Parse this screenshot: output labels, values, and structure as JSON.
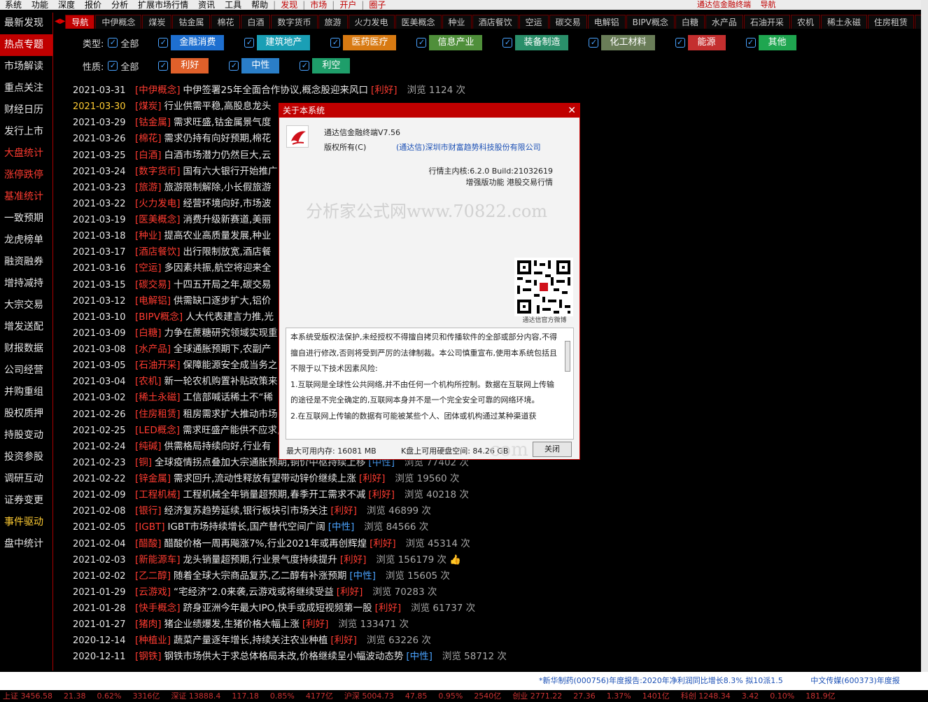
{
  "menu": {
    "items": [
      "系统",
      "功能",
      "深度",
      "报价",
      "分析",
      "扩展市场行情",
      "资讯",
      "工具",
      "帮助"
    ],
    "highlight": [
      "发现",
      "市场",
      "开户",
      "圈子"
    ],
    "brand": "通达信金融终端",
    "nav": "导航"
  },
  "leftnav": {
    "items": [
      {
        "label": "最新发现",
        "style": "normal"
      },
      {
        "label": "热点专题",
        "style": "active"
      },
      {
        "label": "市场解读",
        "style": "normal"
      },
      {
        "label": "重点关注",
        "style": "normal"
      },
      {
        "label": "财经日历",
        "style": "normal"
      },
      {
        "label": "发行上市",
        "style": "normal"
      },
      {
        "label": "大盘统计",
        "style": "red"
      },
      {
        "label": "涨停跌停",
        "style": "red"
      },
      {
        "label": "基准统计",
        "style": "red"
      },
      {
        "label": "一致预期",
        "style": "normal"
      },
      {
        "label": "龙虎榜单",
        "style": "normal"
      },
      {
        "label": "融资融券",
        "style": "normal"
      },
      {
        "label": "增持减持",
        "style": "normal"
      },
      {
        "label": "大宗交易",
        "style": "normal"
      },
      {
        "label": "增发送配",
        "style": "normal"
      },
      {
        "label": "财报数据",
        "style": "normal"
      },
      {
        "label": "公司经营",
        "style": "normal"
      },
      {
        "label": "并购重组",
        "style": "normal"
      },
      {
        "label": "股权质押",
        "style": "normal"
      },
      {
        "label": "持股变动",
        "style": "normal"
      },
      {
        "label": "投资参股",
        "style": "normal"
      },
      {
        "label": "调研互动",
        "style": "normal"
      },
      {
        "label": "证券变更",
        "style": "normal"
      },
      {
        "label": "事件驱动",
        "style": "orange"
      },
      {
        "label": "盘中统计",
        "style": "normal"
      }
    ]
  },
  "tabs": [
    "导航",
    "中伊概念",
    "煤炭",
    "钴金属",
    "棉花",
    "白酒",
    "数字货币",
    "旅游",
    "火力发电",
    "医美概念",
    "种业",
    "酒店餐饮",
    "空运",
    "碳交易",
    "电解铝",
    "BIPV概念",
    "白糖",
    "水产品",
    "石油开采",
    "农机",
    "稀土永磁",
    "住房租赁",
    "MI"
  ],
  "filters": {
    "type_label": "类型:",
    "all_label": "全部",
    "types": [
      {
        "label": "金融消费",
        "color": "#1e6fd0"
      },
      {
        "label": "建筑地产",
        "color": "#1a9fb5"
      },
      {
        "label": "医药医疗",
        "color": "#d87a12"
      },
      {
        "label": "信息产业",
        "color": "#4f8f3a"
      },
      {
        "label": "装备制造",
        "color": "#2a8f6a"
      },
      {
        "label": "化工材料",
        "color": "#6a7d58"
      },
      {
        "label": "能源",
        "color": "#c42f2f"
      },
      {
        "label": "其他",
        "color": "#1fa650"
      }
    ],
    "nature_label": "性质:",
    "natures": [
      {
        "label": "利好",
        "color": "#e0602a"
      },
      {
        "label": "中性",
        "color": "#2a7ec8"
      },
      {
        "label": "利空",
        "color": "#1e9e6a"
      }
    ]
  },
  "news": [
    {
      "date": "2021-03-31",
      "cat": "[中伊概念]",
      "title": "中伊签署25年全面合作协议,概念股迎来风口",
      "tag": "[利好]",
      "tagtype": "good",
      "views": "浏览 1124 次"
    },
    {
      "date": "2021-03-30",
      "cat": "[煤炭]",
      "title": "行业供需平稳,高股息龙头",
      "tag": "",
      "tagtype": "",
      "views": ""
    },
    {
      "date": "2021-03-29",
      "cat": "[钴金属]",
      "title": "需求旺盛,钴金属景气度",
      "tag": "",
      "tagtype": "",
      "views": ""
    },
    {
      "date": "2021-03-26",
      "cat": "[棉花]",
      "title": "需求仍持有向好预期,棉花",
      "tag": "",
      "tagtype": "",
      "views": ""
    },
    {
      "date": "2021-03-25",
      "cat": "[白酒]",
      "title": "白酒市场潜力仍然巨大,云",
      "tag": "",
      "tagtype": "",
      "views": ""
    },
    {
      "date": "2021-03-24",
      "cat": "[数字货币]",
      "title": "国有六大银行开始推广",
      "tag": "",
      "tagtype": "",
      "views": ""
    },
    {
      "date": "2021-03-23",
      "cat": "[旅游]",
      "title": "旅游限制解除,小长假旅游",
      "tag": "",
      "tagtype": "",
      "views": ""
    },
    {
      "date": "2021-03-22",
      "cat": "[火力发电]",
      "title": "经营环境向好,市场波",
      "tag": "",
      "tagtype": "",
      "views": ""
    },
    {
      "date": "2021-03-19",
      "cat": "[医美概念]",
      "title": "消费升级新赛道,美丽",
      "tag": "",
      "tagtype": "",
      "views": ""
    },
    {
      "date": "2021-03-18",
      "cat": "[种业]",
      "title": "提高农业高质量发展,种业",
      "tag": "",
      "tagtype": "",
      "views": ""
    },
    {
      "date": "2021-03-17",
      "cat": "[酒店餐饮]",
      "title": "出行限制放宽,酒店餐",
      "tag": "",
      "tagtype": "",
      "views": ""
    },
    {
      "date": "2021-03-16",
      "cat": "[空运]",
      "title": "多因素共振,航空将迎来全",
      "tag": "",
      "tagtype": "",
      "views": ""
    },
    {
      "date": "2021-03-15",
      "cat": "[碳交易]",
      "title": "十四五开局之年,碳交易",
      "tag": "",
      "tagtype": "",
      "views": ""
    },
    {
      "date": "2021-03-12",
      "cat": "[电解铝]",
      "title": "供需缺口逐步扩大,铝价",
      "tag": "",
      "tagtype": "",
      "views": ""
    },
    {
      "date": "2021-03-10",
      "cat": "[BIPV概念]",
      "title": "人大代表建言力推,光",
      "tag": "",
      "tagtype": "",
      "views": ""
    },
    {
      "date": "2021-03-09",
      "cat": "[白糖]",
      "title": "力争在蔗糖研究领域实现重",
      "tag": "",
      "tagtype": "",
      "views": ""
    },
    {
      "date": "2021-03-08",
      "cat": "[水产品]",
      "title": "全球通胀预期下,农副产",
      "tag": "",
      "tagtype": "",
      "views": ""
    },
    {
      "date": "2021-03-05",
      "cat": "[石油开采]",
      "title": "保障能源安全成当务之",
      "tag": "",
      "tagtype": "",
      "views": ""
    },
    {
      "date": "2021-03-04",
      "cat": "[农机]",
      "title": "新一轮农机购置补贴政策来",
      "tag": "",
      "tagtype": "",
      "views": ""
    },
    {
      "date": "2021-03-02",
      "cat": "[稀土永磁]",
      "title": "工信部喊话稀土不“稀",
      "tag": "",
      "tagtype": "",
      "views": ""
    },
    {
      "date": "2021-02-26",
      "cat": "[住房租赁]",
      "title": "租房需求扩大推动市场",
      "tag": "",
      "tagtype": "",
      "views": ""
    },
    {
      "date": "2021-02-25",
      "cat": "[LED概念]",
      "title": "需求旺盛产能供不应求,",
      "tag": "",
      "tagtype": "",
      "views": ""
    },
    {
      "date": "2021-02-24",
      "cat": "[纯碱]",
      "title": "供需格局持续向好,行业有",
      "tag": "",
      "tagtype": "",
      "views": ""
    },
    {
      "date": "2021-02-23",
      "cat": "[铜]",
      "title": "全球疫情拐点叠加大宗通胀预期,铜价中枢持续上移",
      "tag": "[中性]",
      "tagtype": "mid",
      "views": "浏览 77402 次"
    },
    {
      "date": "2021-02-22",
      "cat": "[锌金属]",
      "title": "需求回升,流动性释放有望带动锌价继续上涨",
      "tag": "[利好]",
      "tagtype": "good",
      "views": "浏览 19560 次"
    },
    {
      "date": "2021-02-09",
      "cat": "[工程机械]",
      "title": "工程机械全年销量超预期,春季开工需求不减",
      "tag": "[利好]",
      "tagtype": "good",
      "views": "浏览 40218 次"
    },
    {
      "date": "2021-02-08",
      "cat": "[银行]",
      "title": "经济复苏趋势延续,银行板块引市场关注",
      "tag": "[利好]",
      "tagtype": "good",
      "views": "浏览 46899 次"
    },
    {
      "date": "2021-02-05",
      "cat": "[IGBT]",
      "title": "IGBT市场持续增长,国产替代空间广阔",
      "tag": "[中性]",
      "tagtype": "mid",
      "views": "浏览 84566 次"
    },
    {
      "date": "2021-02-04",
      "cat": "[醋酸]",
      "title": "醋酸价格一周再飚涨7%,行业2021年或再创辉煌",
      "tag": "[利好]",
      "tagtype": "good",
      "views": "浏览 45314 次"
    },
    {
      "date": "2021-02-03",
      "cat": "[新能源车]",
      "title": "龙头销量超预期,行业景气度持续提升",
      "tag": "[利好]",
      "tagtype": "good",
      "views": "浏览 156179 次 👍"
    },
    {
      "date": "2021-02-02",
      "cat": "[乙二醇]",
      "title": "随着全球大宗商品复苏,乙二醇有补涨预期",
      "tag": "[中性]",
      "tagtype": "mid",
      "views": "浏览 15605 次"
    },
    {
      "date": "2021-01-29",
      "cat": "[云游戏]",
      "title": "“宅经济”2.0来袭,云游戏或将继续受益",
      "tag": "[利好]",
      "tagtype": "good",
      "views": "浏览 70283 次"
    },
    {
      "date": "2021-01-28",
      "cat": "[快手概念]",
      "title": "跻身亚洲今年最大IPO,快手或成短视频第一股",
      "tag": "[利好]",
      "tagtype": "good",
      "views": "浏览 61737 次"
    },
    {
      "date": "2021-01-27",
      "cat": "[猪肉]",
      "title": "猪企业绩爆发,生猪价格大幅上涨",
      "tag": "[利好]",
      "tagtype": "good",
      "views": "浏览 133471 次"
    },
    {
      "date": "2020-12-14",
      "cat": "[种植业]",
      "title": "蔬菜产量逐年增长,持续关注农业种植",
      "tag": "[利好]",
      "tagtype": "good",
      "views": "浏览 63226 次"
    },
    {
      "date": "2020-12-11",
      "cat": "[钢铁]",
      "title": "钢铁市场供大于求总体格局未改,价格继续呈小幅波动态势",
      "tag": "[中性]",
      "tagtype": "mid",
      "views": "浏览 58712 次"
    }
  ],
  "ticker": [
    "*新华制药(000756)年度报告:2020年净利润同比增长8.3% 拟10派1.5",
    "中文传媒(600373)年度报"
  ],
  "statusbar": [
    "上证 3456.58",
    "21.38",
    "0.62%",
    "3316亿",
    "深证 13888.4",
    "117.18",
    "0.85%",
    "4177亿",
    "沪深 5004.73",
    "47.85",
    "0.95%",
    "2540亿",
    "创业 2771.22",
    "27.36",
    "1.37%",
    "1401亿",
    "科创 1248.34",
    "3.42",
    "0.10%",
    "181.9亿"
  ],
  "dialog": {
    "title": "关于本系统",
    "app_name": "通达信金融终端V7.56",
    "copyright_label": "版权所有(C)",
    "copyright_company": "(通达信)深圳市财富趋势科技股份有限公司",
    "kernel": "行情主内核:6.2.0 Build:21032619",
    "features": "增强版功能 港股交易行情",
    "watermark": "分析家公式网www.70822.com",
    "qr_caption": "通达信官方微博",
    "license": [
      "本系统受版权法保护,未经授权不得擅自拷贝和传播软件的全部或部分内容,不得擅自进行修改,否则将受到严厉的法律制裁。本公司慎重宣布,使用本系统包括且不限于以下技术因素风险:",
      "1.互联网是全球性公共网络,并不由任何一个机构所控制。数据在互联网上传输的途径是不完全确定的,互联网本身并不是一个完全安全可靠的网络环境。",
      "2.在互联网上传输的数据有可能被某些个人、团体或机构通过某种渠道获"
    ],
    "memory": "最大可用内存: 16081 MB",
    "disk": "K盘上可用硬盘空间: 84.26 GB",
    "close_label": "关闭"
  },
  "watermark2": "com",
  "colors": {
    "accent": "#c00000",
    "good": "#ff3b30",
    "neutral": "#4aa3ff"
  }
}
